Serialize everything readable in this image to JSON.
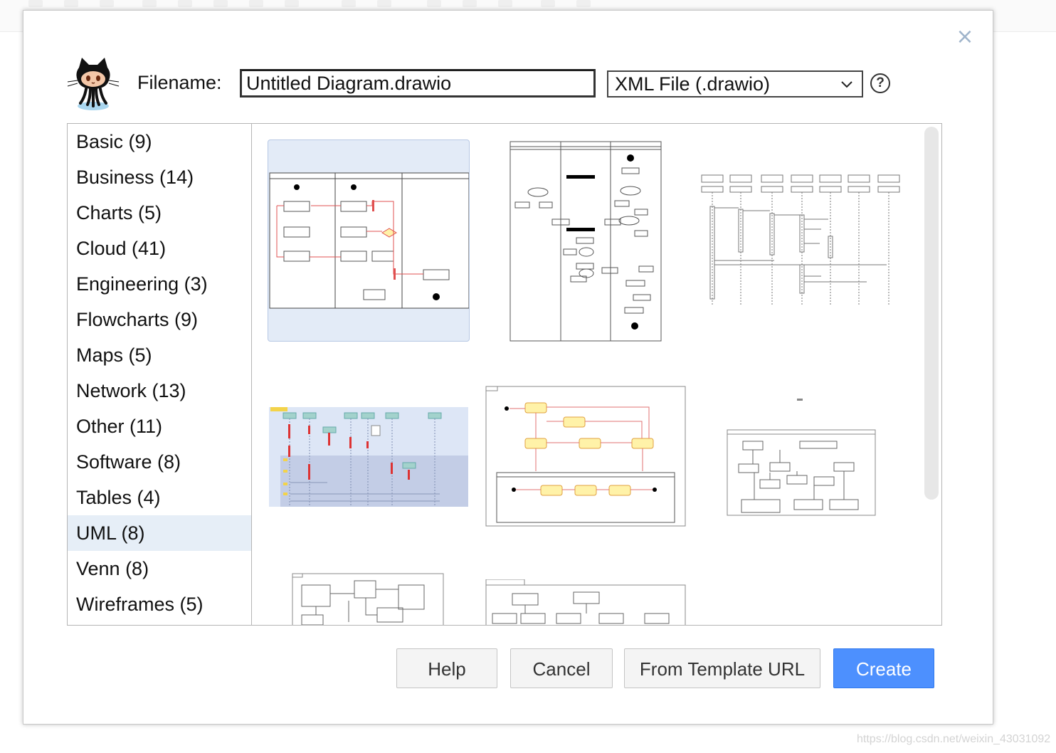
{
  "dialog": {
    "filename_label": "Filename:",
    "filename_value": "Untitled Diagram.drawio",
    "format_selected": "XML File (.drawio)",
    "format_options": [
      "XML File (.drawio)"
    ],
    "help_icon_glyph": "?",
    "close_glyph": "×",
    "logo_icon": "octocat-icon"
  },
  "categories": [
    {
      "label": "Basic (9)",
      "selected": false
    },
    {
      "label": "Business (14)",
      "selected": false
    },
    {
      "label": "Charts (5)",
      "selected": false
    },
    {
      "label": "Cloud (41)",
      "selected": false
    },
    {
      "label": "Engineering (3)",
      "selected": false
    },
    {
      "label": "Flowcharts (9)",
      "selected": false
    },
    {
      "label": "Maps (5)",
      "selected": false
    },
    {
      "label": "Network (13)",
      "selected": false
    },
    {
      "label": "Other (11)",
      "selected": false
    },
    {
      "label": "Software (8)",
      "selected": false
    },
    {
      "label": "Tables (4)",
      "selected": false
    },
    {
      "label": "UML (8)",
      "selected": true
    },
    {
      "label": "Venn (8)",
      "selected": false
    },
    {
      "label": "Wireframes (5)",
      "selected": false
    }
  ],
  "templates": [
    {
      "name": "uml-activity-swimlanes",
      "selected": true
    },
    {
      "name": "uml-activity-fork-join",
      "selected": false
    },
    {
      "name": "uml-sequence-lifelines",
      "selected": false
    },
    {
      "name": "uml-sequence-colored",
      "selected": false
    },
    {
      "name": "uml-state-machine",
      "selected": false
    },
    {
      "name": "uml-class-package",
      "selected": false
    },
    {
      "name": "uml-class-diagram",
      "selected": false
    },
    {
      "name": "uml-component-diagram",
      "selected": false
    }
  ],
  "buttons": {
    "help": "Help",
    "cancel": "Cancel",
    "from_template_url": "From Template URL",
    "create": "Create"
  },
  "colors": {
    "accent": "#4d90fe",
    "selection": "#e6eef7",
    "thumb_red": "#e05050",
    "thumb_yellow": "#fff2a8"
  },
  "watermark": "https://blog.csdn.net/weixin_43031092"
}
